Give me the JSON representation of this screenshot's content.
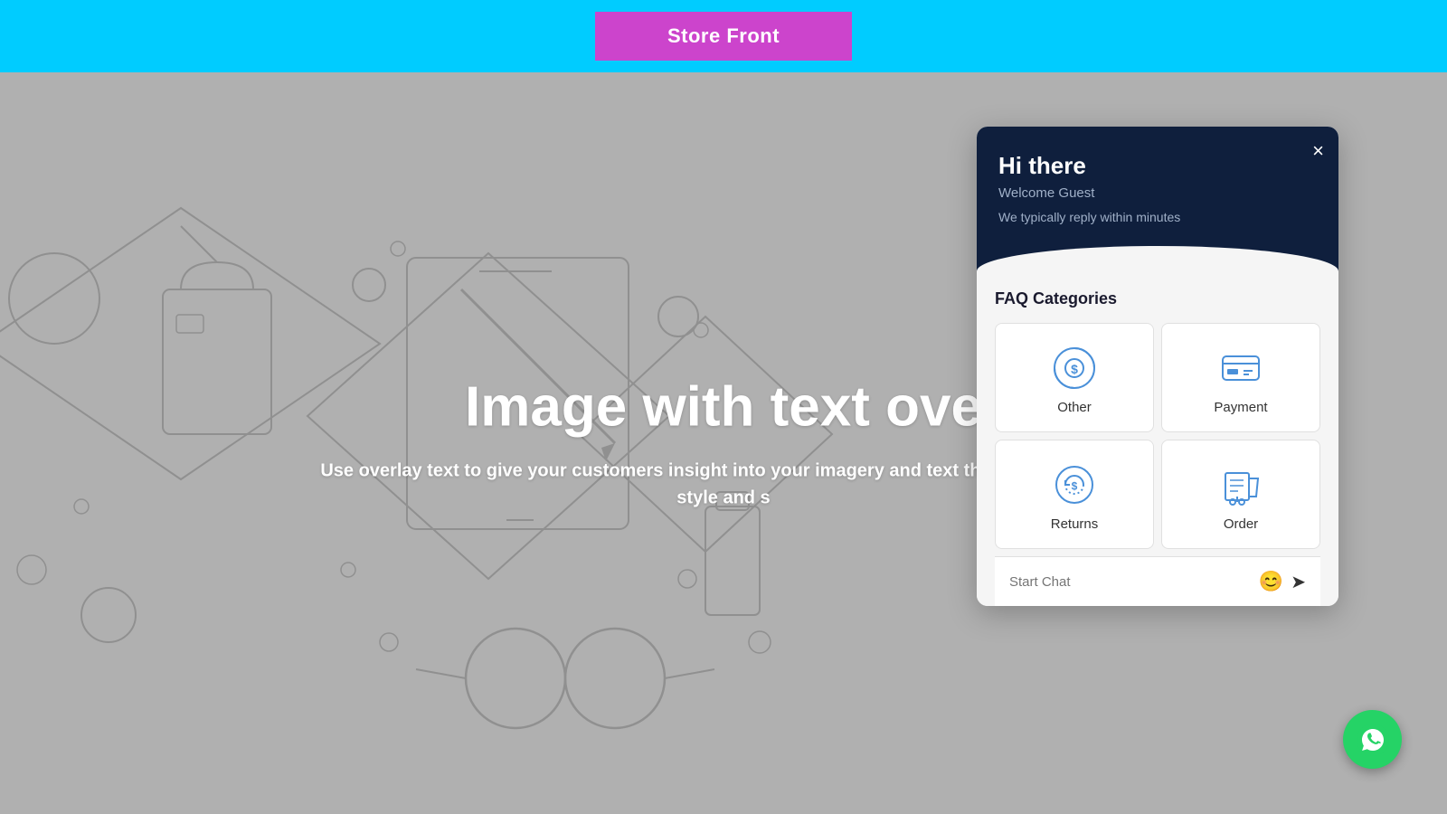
{
  "topbar": {
    "bg_color": "#00ccff",
    "button_label": "Store Front",
    "button_bg": "#cc44cc"
  },
  "overlay": {
    "heading": "Image with text ove",
    "subtext": "Use overlay text to give your customers insight into your\nimagery and text that relates to your style and s"
  },
  "chat": {
    "greeting": "Hi there",
    "welcome": "Welcome Guest",
    "reply_time": "We typically reply within minutes",
    "close_label": "×",
    "faq_title": "FAQ Categories",
    "categories": [
      {
        "id": "other",
        "label": "Other",
        "icon": "other"
      },
      {
        "id": "payment",
        "label": "Payment",
        "icon": "payment"
      },
      {
        "id": "returns",
        "label": "Returns",
        "icon": "returns"
      },
      {
        "id": "order",
        "label": "Order",
        "icon": "order"
      }
    ],
    "input_placeholder": "Start Chat",
    "emoji_icon": "😊",
    "send_icon": "➤"
  },
  "whatsapp": {
    "label": "WhatsApp"
  }
}
